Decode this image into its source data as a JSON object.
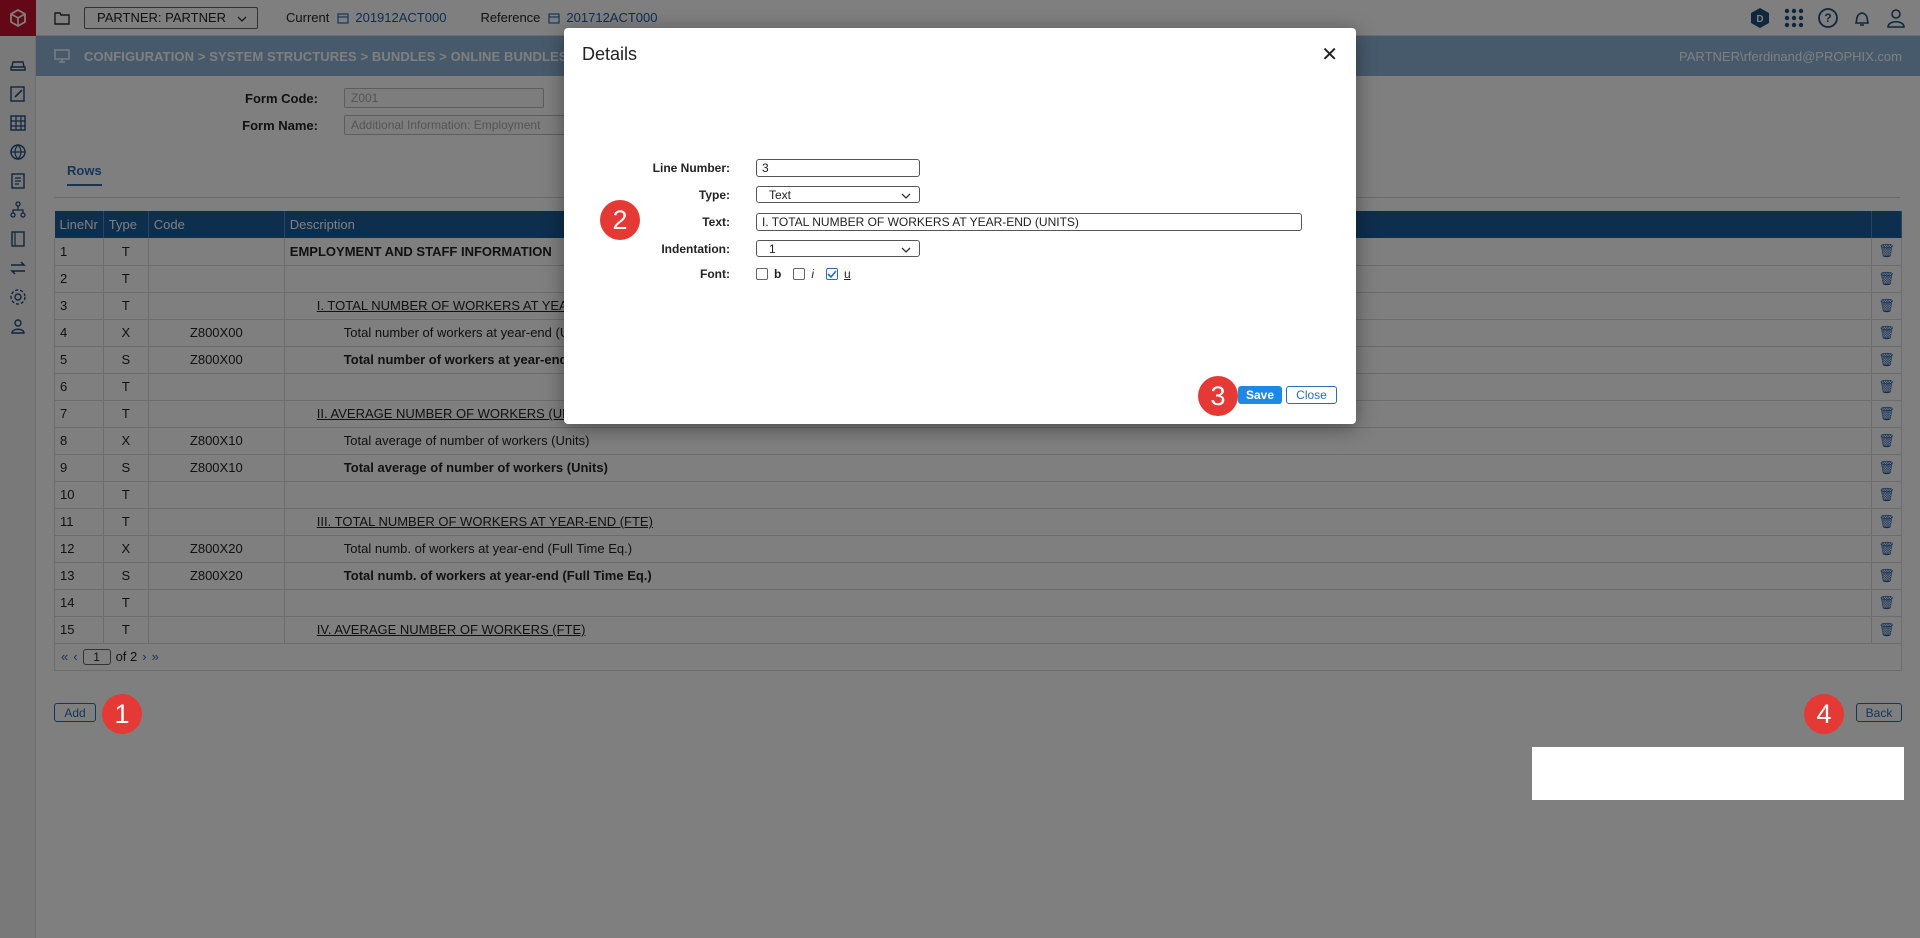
{
  "topbar": {
    "partner_select": "PARTNER: PARTNER",
    "current_label": "Current",
    "current_value": "201912ACT000",
    "reference_label": "Reference",
    "reference_value": "201712ACT000",
    "badge_letter": "D"
  },
  "breadcrumb": "CONFIGURATION > SYSTEM STRUCTURES > BUNDLES > ONLINE BUNDLES SETUP >",
  "user": "PARTNER\\rferdinand@PROPHIX.com",
  "form": {
    "code_label": "Form Code:",
    "code_value": "Z001",
    "name_label": "Form Name:",
    "name_value": "Additional Information: Employment"
  },
  "tabs": {
    "rows": "Rows"
  },
  "table": {
    "headers": [
      "LineNr",
      "Type",
      "Code",
      "Description"
    ],
    "rows": [
      {
        "line": "1",
        "type": "T",
        "code": "",
        "desc": "EMPLOYMENT AND STAFF INFORMATION"
      },
      {
        "line": "2",
        "type": "T",
        "code": "",
        "desc": ""
      },
      {
        "line": "3",
        "type": "T",
        "code": "",
        "desc": "I. TOTAL NUMBER OF WORKERS AT YEAR-END"
      },
      {
        "line": "4",
        "type": "X",
        "code": "Z800X00",
        "desc": "Total number of workers at year-end (Units)"
      },
      {
        "line": "5",
        "type": "S",
        "code": "Z800X00",
        "desc": "Total number of workers at year-end (Units)"
      },
      {
        "line": "6",
        "type": "T",
        "code": "",
        "desc": ""
      },
      {
        "line": "7",
        "type": "T",
        "code": "",
        "desc": "II. AVERAGE NUMBER OF WORKERS (UNITS)"
      },
      {
        "line": "8",
        "type": "X",
        "code": "Z800X10",
        "desc": "Total average of number of workers (Units)"
      },
      {
        "line": "9",
        "type": "S",
        "code": "Z800X10",
        "desc": "Total average of number of workers (Units)"
      },
      {
        "line": "10",
        "type": "T",
        "code": "",
        "desc": ""
      },
      {
        "line": "11",
        "type": "T",
        "code": "",
        "desc": "III. TOTAL NUMBER OF WORKERS AT YEAR-END (FTE)"
      },
      {
        "line": "12",
        "type": "X",
        "code": "Z800X20",
        "desc": "Total numb. of workers at year-end (Full Time Eq.)"
      },
      {
        "line": "13",
        "type": "S",
        "code": "Z800X20",
        "desc": "Total numb. of workers at year-end (Full Time Eq.)"
      },
      {
        "line": "14",
        "type": "T",
        "code": "",
        "desc": ""
      },
      {
        "line": "15",
        "type": "T",
        "code": "",
        "desc": "IV. AVERAGE NUMBER OF WORKERS (FTE)"
      }
    ]
  },
  "pager": {
    "page": "1",
    "of": "of 2"
  },
  "buttons": {
    "add": "Add",
    "back": "Back"
  },
  "badges": {
    "one": "1",
    "two": "2",
    "three": "3",
    "four": "4"
  },
  "modal": {
    "title": "Details",
    "line_number_label": "Line Number:",
    "line_number_value": "3",
    "type_label": "Type:",
    "type_value": "Text",
    "text_label": "Text:",
    "text_value": "I. TOTAL NUMBER OF WORKERS AT YEAR-END (UNITS)",
    "indentation_label": "Indentation:",
    "indentation_value": "1",
    "font_label": "Font:",
    "font_bold": "b",
    "font_italic": "i",
    "font_underline": "u",
    "save": "Save",
    "close": "Close"
  }
}
